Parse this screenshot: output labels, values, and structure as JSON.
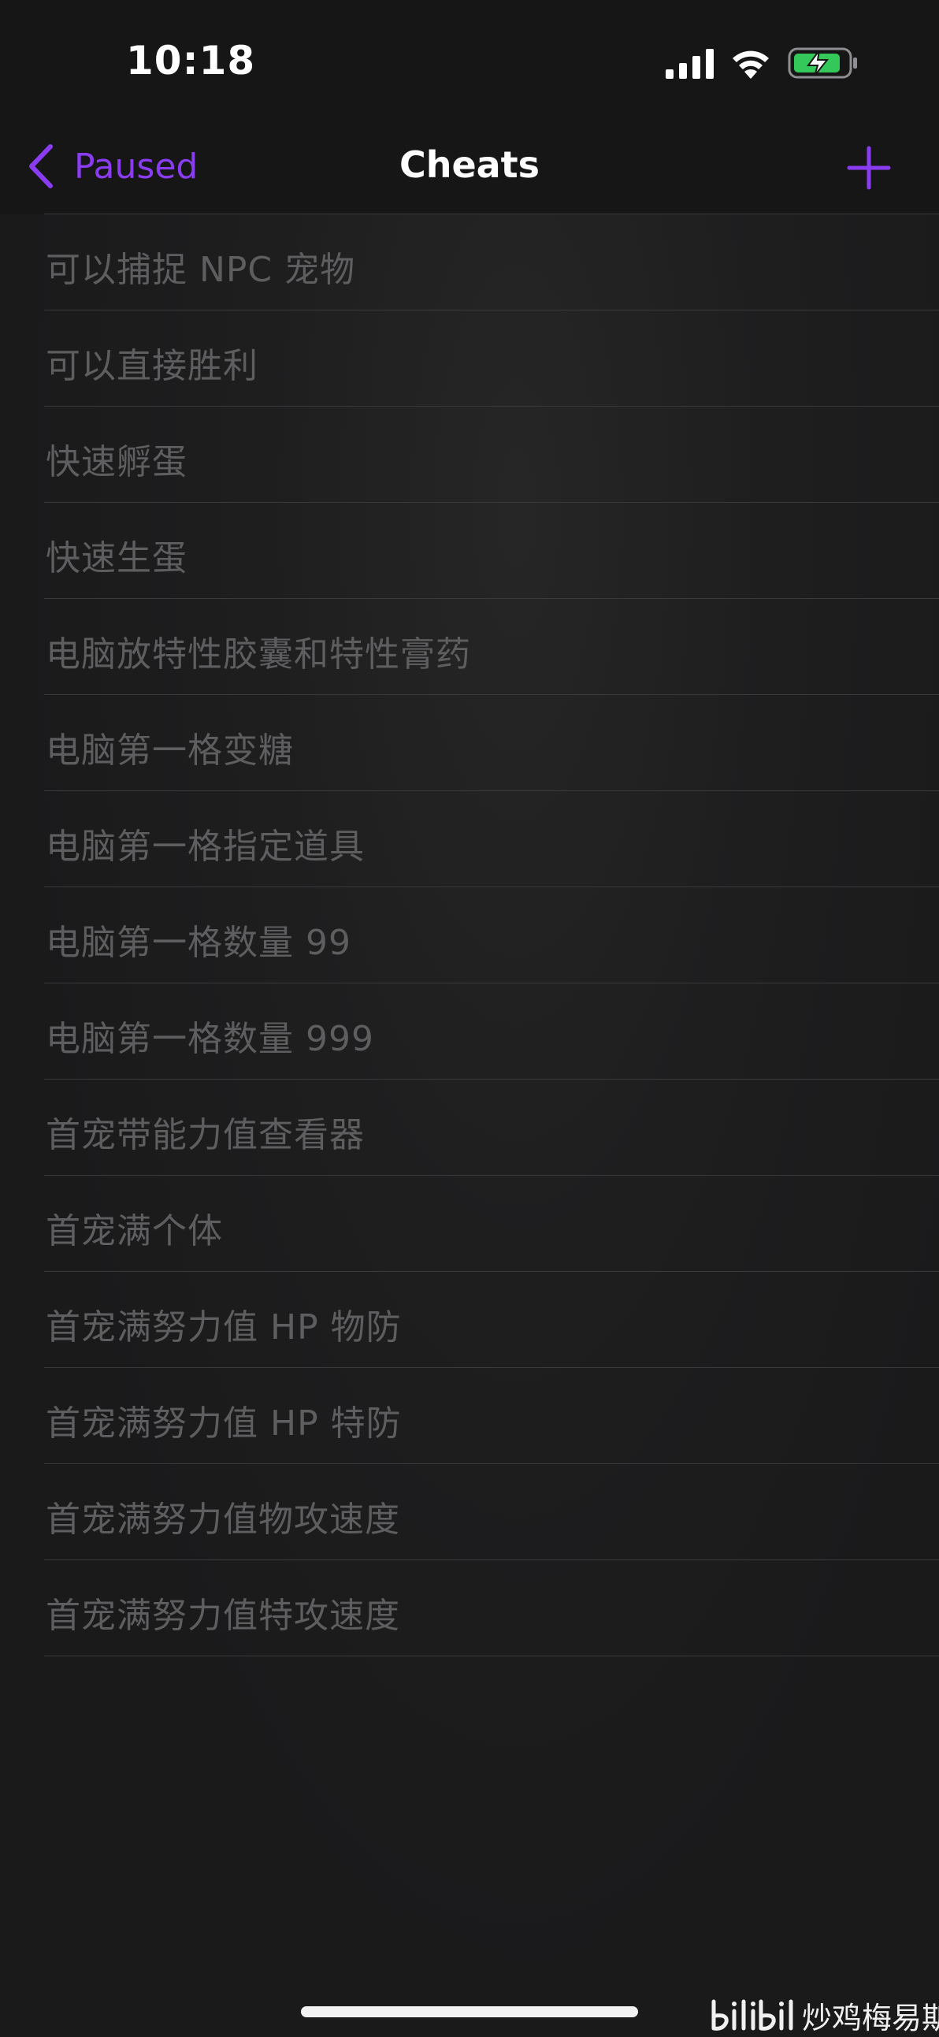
{
  "status_bar": {
    "time": "10:18",
    "icons": [
      "signal-icon",
      "wifi-icon",
      "battery-charging-icon"
    ]
  },
  "nav": {
    "back_label": "Paused",
    "title": "Cheats",
    "add_icon": "plus-icon"
  },
  "colors": {
    "accent": "#8a3cf0",
    "background": "#1a1a1b",
    "item_text": "#5e5e60",
    "separator": "#3a3a3c",
    "battery_fill": "#34c759"
  },
  "cheats": [
    {
      "label": "可以捕捉 NPC 宠物"
    },
    {
      "label": "可以直接胜利"
    },
    {
      "label": "快速孵蛋"
    },
    {
      "label": "快速生蛋"
    },
    {
      "label": "电脑放特性胶囊和特性膏药"
    },
    {
      "label": "电脑第一格变糖"
    },
    {
      "label": "电脑第一格指定道具"
    },
    {
      "label": "电脑第一格数量 99"
    },
    {
      "label": "电脑第一格数量 999"
    },
    {
      "label": "首宠带能力值查看器"
    },
    {
      "label": "首宠满个体"
    },
    {
      "label": "首宠满努力值 HP 物防"
    },
    {
      "label": "首宠满努力值 HP 特防"
    },
    {
      "label": "首宠满努力值物攻速度"
    },
    {
      "label": "首宠满努力值特攻速度"
    }
  ],
  "watermark": {
    "text": "炒鸡梅易斯"
  }
}
